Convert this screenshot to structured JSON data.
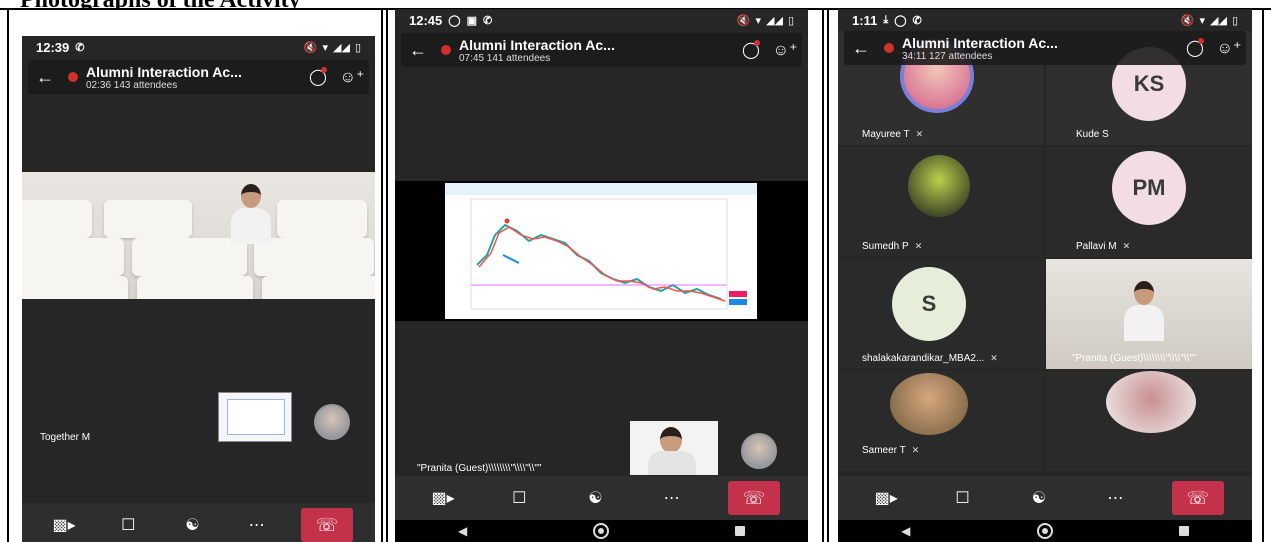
{
  "document": {
    "heading": "Photographs of the Activity"
  },
  "phones": [
    {
      "time": "12:39",
      "call_title": "Alumni Interaction Ac...",
      "call_sub": "02:36  143 attendees",
      "label_bottom": "Together M"
    },
    {
      "time": "12:45",
      "call_title": "Alumni Interaction Ac...",
      "call_sub": "07:45  141 attendees",
      "label_bottom": "\"Pranita (Guest)\\\\\\\\\\\\\\\\\"\\\\\\\\\"\\\\\"\""
    },
    {
      "time": "1:11",
      "call_title": "Alumni Interaction Ac...",
      "call_sub": "34:11  127 attendees",
      "participants": [
        {
          "name": "Mayuree T",
          "initials": ""
        },
        {
          "name": "Kude S",
          "initials": "KS"
        },
        {
          "name": "Sumedh P",
          "initials": ""
        },
        {
          "name": "Pallavi M",
          "initials": "PM"
        },
        {
          "name": "shalakakarandikar_MBA2...",
          "initials": "S"
        },
        {
          "name": "\"Pranita (Guest)\\\\\\\\\\\\\\\\\"\\\\\\\\\"\\\\\"\"",
          "initials": ""
        },
        {
          "name": "Sameer T",
          "initials": ""
        },
        {
          "name": "",
          "initials": ""
        }
      ]
    }
  ],
  "colors": {
    "hangup": "#c4314b",
    "record_dot": "#d0312d",
    "app_bg": "#262626"
  },
  "icons": {
    "back": "back-arrow-icon",
    "chat": "chat-icon",
    "people": "add-people-icon",
    "camera": "video-off-icon",
    "mic": "mic-off-icon",
    "audio": "headset-icon",
    "more": "more-icon",
    "hangup": "hang-up-icon"
  }
}
